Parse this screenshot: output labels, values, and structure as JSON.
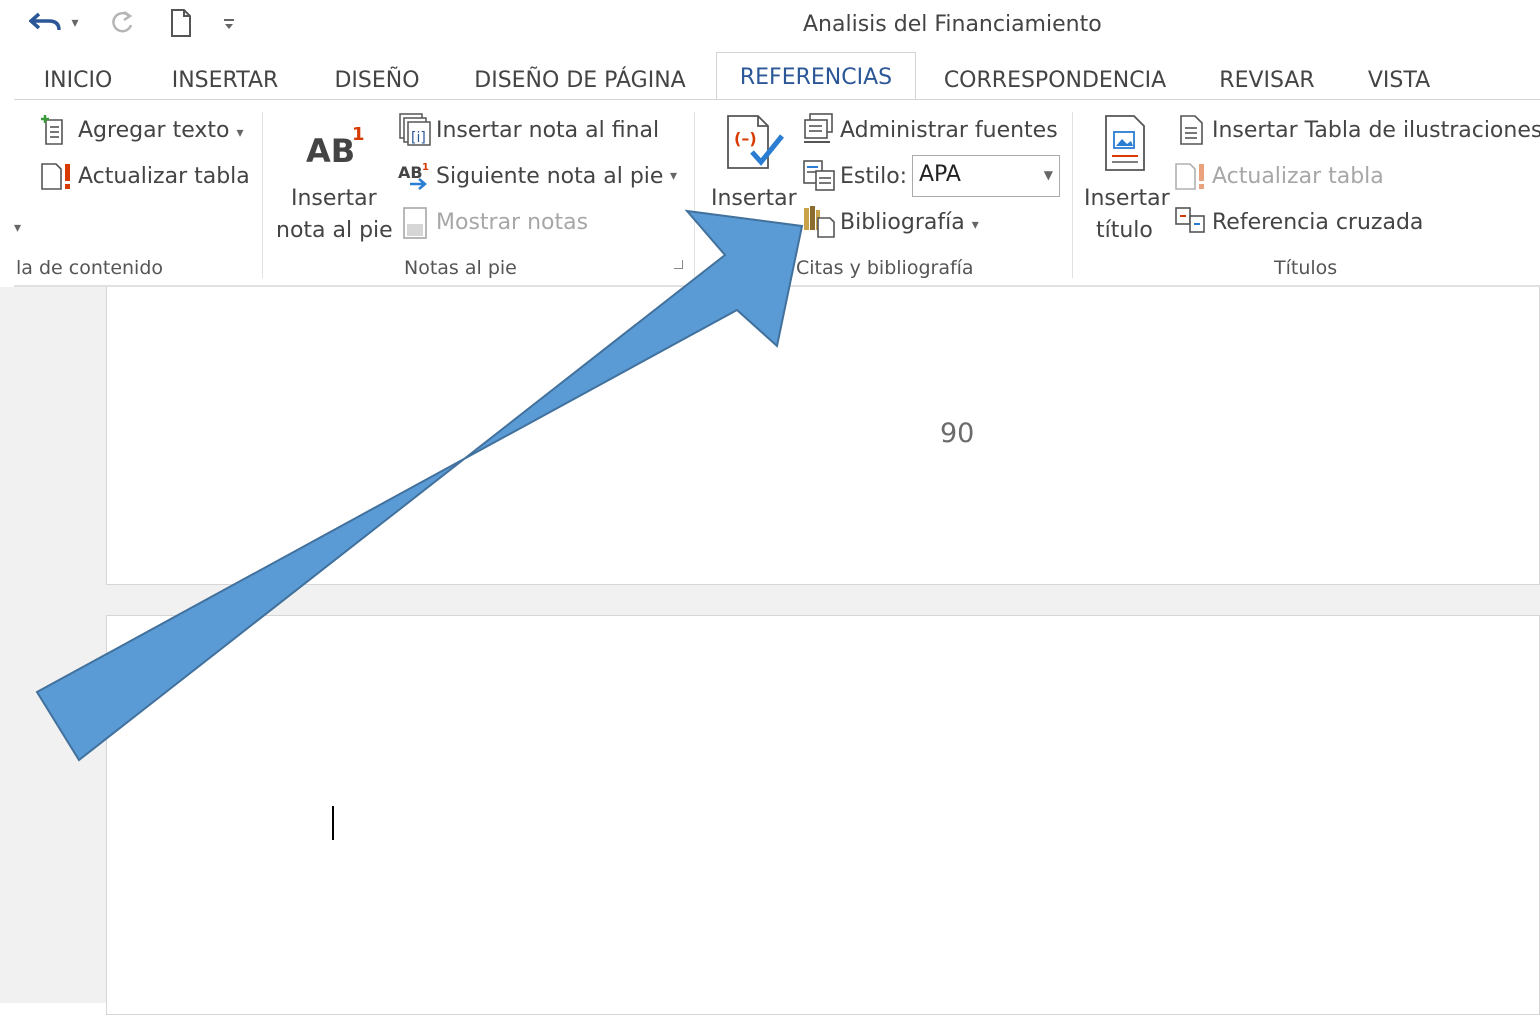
{
  "titlebar": {
    "document_title": "Analisis del Financiamiento",
    "icons": [
      "undo-icon",
      "dropdown-caret-icon",
      "redo-icon",
      "new-document-icon",
      "customize-qat-icon"
    ]
  },
  "tabs": [
    {
      "label": "INICIO"
    },
    {
      "label": "INSERTAR"
    },
    {
      "label": "DISEÑO"
    },
    {
      "label": "DISEÑO DE PÁGINA"
    },
    {
      "label": "REFERENCIAS",
      "active": true
    },
    {
      "label": "CORRESPONDENCIA"
    },
    {
      "label": "REVISAR"
    },
    {
      "label": "VISTA"
    }
  ],
  "ribbon": {
    "toc_group": {
      "agregar_texto": "Agregar texto",
      "actualizar_tabla": "Actualizar tabla",
      "label": "la de contenido"
    },
    "footnotes_group": {
      "insertar_nota_line1": "Insertar",
      "insertar_nota_line2": "nota al pie",
      "insertar_nota_final": "Insertar nota al final",
      "siguiente_nota": "Siguiente nota al pie",
      "mostrar_notas": "Mostrar notas",
      "label": "Notas al pie"
    },
    "citations_group": {
      "insertar_cita_line1": "Insertar",
      "administrar_fuentes": "Administrar fuentes",
      "estilo_label": "Estilo:",
      "estilo_value": "APA",
      "bibliografia": "Bibliografía",
      "label": "Citas y bibliografía"
    },
    "captions_group": {
      "insertar_titulo_line1": "Insertar",
      "insertar_titulo_line2": "título",
      "insertar_tabla_ilustraciones": "Insertar Tabla de ilustraciones",
      "actualizar_tabla": "Actualizar tabla",
      "referencia_cruzada": "Referencia cruzada",
      "label": "Títulos"
    }
  },
  "document": {
    "page_number": "90"
  },
  "colors": {
    "arrow_fill": "#5b9bd5",
    "arrow_stroke": "#41719c",
    "active_tab_text": "#2b5797"
  }
}
